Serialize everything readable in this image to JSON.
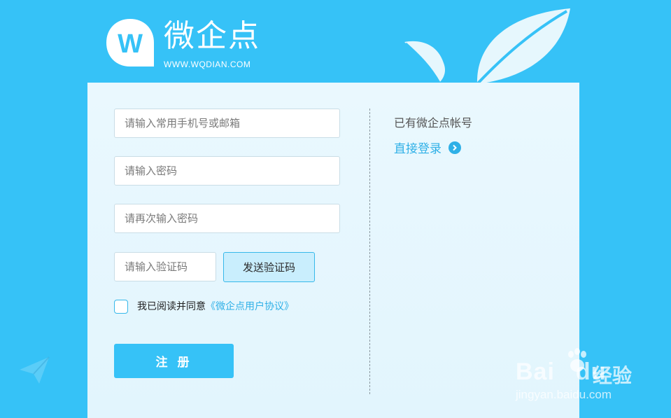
{
  "brand": {
    "logo_letter": "W",
    "name": "微企点",
    "url": "WWW.WQDIAN.COM"
  },
  "form": {
    "account_placeholder": "请输入常用手机号或邮箱",
    "password_placeholder": "请输入密码",
    "confirm_password_placeholder": "请再次输入密码",
    "code_placeholder": "请输入验证码",
    "send_code_label": "发送验证码",
    "agree_text": "我已阅读并同意",
    "agreement_link": "《微企点用户协议》",
    "register_label": "注 册"
  },
  "side": {
    "has_account": "已有微企点帐号",
    "login_link": "直接登录"
  },
  "watermark": {
    "baidu": "Bai",
    "baidu_du": "du",
    "jingyan": "经验",
    "url": "jingyan.baidu.com"
  },
  "colors": {
    "background": "#36c2f7",
    "accent": "#2fb0e7",
    "panel": "#e6f7fe"
  },
  "icons": [
    "logo-w-icon",
    "leaf-icon",
    "paper-plane-icon",
    "chevron-right-icon",
    "paw-icon"
  ]
}
